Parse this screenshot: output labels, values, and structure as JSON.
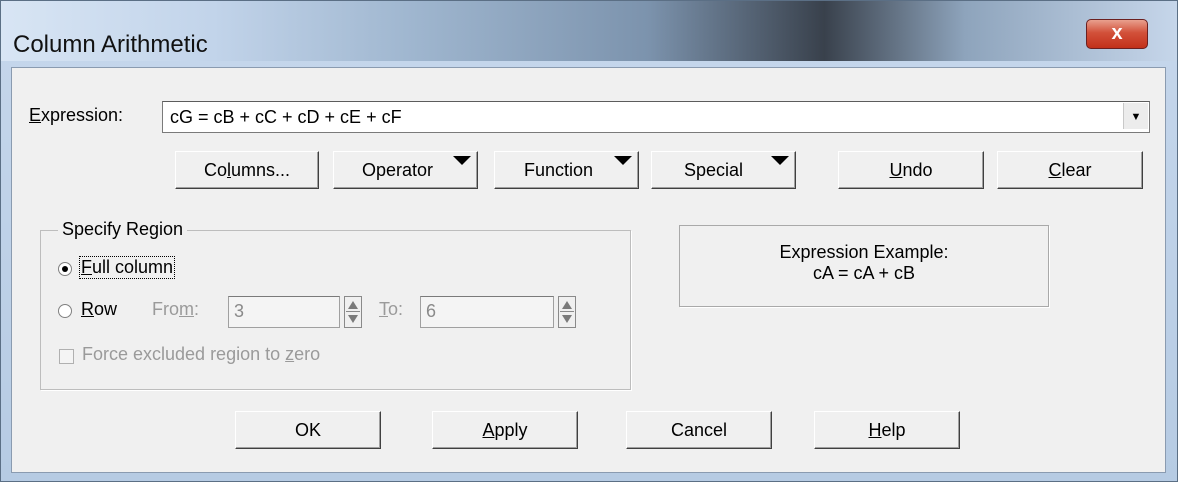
{
  "window": {
    "title": "Column Arithmetic",
    "close_glyph": "x"
  },
  "expression": {
    "label_pre": "",
    "label_mnemonic": "E",
    "label_post": "xpression:",
    "value": "cG = cB + cC + cD + cE + cF",
    "dropdown_icon": "chevron-down-icon"
  },
  "toolbar": {
    "columns": {
      "pre": "Co",
      "mnemonic": "l",
      "post": "umns..."
    },
    "operator": "Operator",
    "function": "Function",
    "special": "Special",
    "undo": {
      "mnemonic": "U",
      "post": "ndo"
    },
    "clear": {
      "mnemonic": "C",
      "post": "lear"
    }
  },
  "region": {
    "title": "Specify Region",
    "full_column": {
      "mnemonic": "F",
      "post": "ull column",
      "selected": true
    },
    "row": {
      "mnemonic": "R",
      "post": "ow",
      "selected": false
    },
    "from_label": {
      "pre": "Fro",
      "mnemonic": "m",
      "post": ":"
    },
    "from_value": "3",
    "to_label": {
      "mnemonic": "T",
      "post": "o:"
    },
    "to_value": "6",
    "force_zero": {
      "pre": "Force excluded region to ",
      "mnemonic": "z",
      "post": "ero",
      "checked": false
    }
  },
  "example": {
    "line1": "Expression Example:",
    "line2": "cA = cA + cB"
  },
  "buttons": {
    "ok": "OK",
    "apply": {
      "mnemonic": "A",
      "post": "pply"
    },
    "cancel": "Cancel",
    "help": {
      "mnemonic": "H",
      "post": "elp"
    }
  }
}
